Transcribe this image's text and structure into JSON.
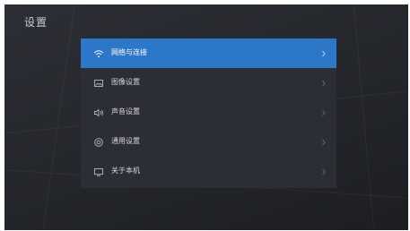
{
  "page": {
    "title": "设置"
  },
  "menu": {
    "items": [
      {
        "label": "网络与连接",
        "icon": "wifi-icon",
        "selected": true
      },
      {
        "label": "图像设置",
        "icon": "picture-icon",
        "selected": false
      },
      {
        "label": "声音设置",
        "icon": "speaker-icon",
        "selected": false
      },
      {
        "label": "通用设置",
        "icon": "gear-icon",
        "selected": false
      },
      {
        "label": "关于本机",
        "icon": "monitor-icon",
        "selected": false
      }
    ]
  },
  "colors": {
    "selected_background": "#2d77c8",
    "panel_background": "#2c2f35",
    "text": "#d4d6da"
  }
}
